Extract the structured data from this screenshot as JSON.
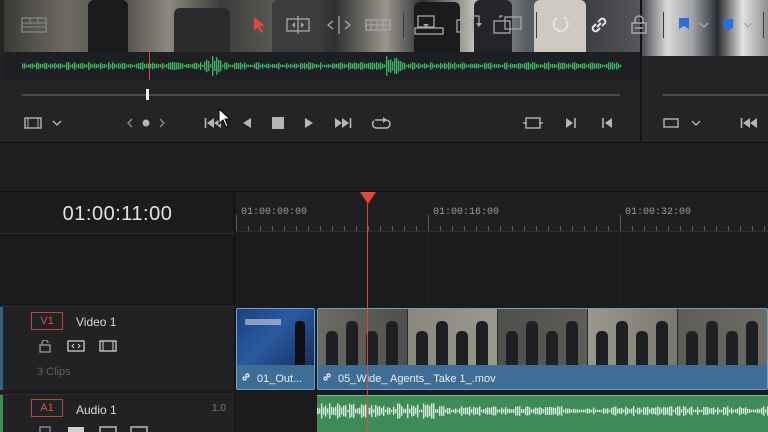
{
  "timeline": {
    "timecode": "01:00:11:00",
    "ruler_labels": [
      "01:00:00:00",
      "01:00:16:00",
      "01:00:32:00"
    ]
  },
  "tracks": {
    "video": {
      "id": "V1",
      "name": "Video 1",
      "clips_count": "3 Clips"
    },
    "audio": {
      "id": "A1",
      "name": "Audio 1",
      "level": "1.0"
    }
  },
  "clips": [
    {
      "label": "01_Out..."
    },
    {
      "label": "05_Wide_ Agents_ Take 1_.mov"
    }
  ],
  "colors": {
    "accent_red": "#e0483a",
    "video_clip": "#3e6e95",
    "audio_clip": "#3f8b58",
    "flag_blue": "#2d6fd6"
  },
  "icons": [
    "viewer-mode-icon",
    "chevron-down-icon",
    "prev-arrow-icon",
    "next-arrow-icon",
    "jump-start-icon",
    "play-reverse-icon",
    "stop-icon",
    "play-icon",
    "jump-end-icon",
    "loop-icon",
    "match-frame-icon",
    "next-edit-icon",
    "prev-edit-icon",
    "layout-icon",
    "selection-arrow-icon",
    "trim-icon",
    "blade-icon",
    "razor-icon",
    "insert-icon",
    "overwrite-icon",
    "replace-icon",
    "snapping-icon",
    "linked-selection-icon",
    "lock-position-icon",
    "flag-icon",
    "marker-icon",
    "lock-icon",
    "auto-select-icon",
    "film-icon",
    "link-icon"
  ]
}
